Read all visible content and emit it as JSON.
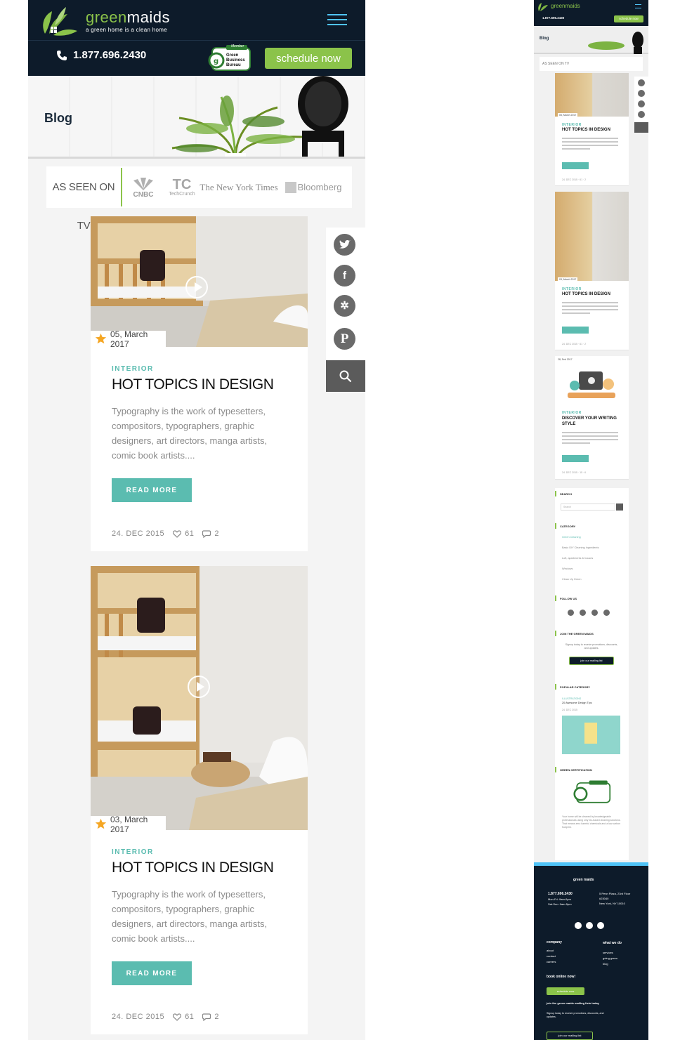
{
  "brand": {
    "name_green": "green",
    "name_white": "maids",
    "tagline": "a green home is a clean home"
  },
  "header": {
    "phone": "1.877.696.2430",
    "gbb_member": "Member",
    "gbb_name": "Green Business Bureau",
    "schedule_label": "schedule now"
  },
  "hero": {
    "title": "Blog"
  },
  "as_seen": {
    "label": "AS SEEN ON TV",
    "outlets": [
      "CNBC",
      "TechCrunch",
      "The New York Times",
      "Bloomberg"
    ]
  },
  "posts": [
    {
      "date": "05, March 2017",
      "category": "INTERIOR",
      "title": "HOT TOPICS IN DESIGN",
      "excerpt": "Typography is the work of typesetters, compositors, typographers, graphic designers, art directors, manga artists, comic book artists....",
      "read_more": "READ MORE",
      "posted": "24. DEC 2015",
      "likes": "61",
      "comments": "2"
    },
    {
      "date": "03, March 2017",
      "category": "INTERIOR",
      "title": "HOT TOPICS IN DESIGN",
      "excerpt": "Typography is the work of typesetters, compositors, typographers, graphic designers, art directors, manga artists, comic book artists....",
      "read_more": "READ MORE",
      "posted": "24. DEC 2015",
      "likes": "61",
      "comments": "2"
    }
  ],
  "thumb": {
    "brand": "greenmaids",
    "phone": "1.877.696.2430",
    "schedule": "schedule now",
    "hero": "Blog",
    "as_seen": "AS SEEN ON TV",
    "posts": [
      {
        "date": "05, March 2017",
        "category": "INTERIOR",
        "title": "HOT TOPICS IN DESIGN",
        "posted": "24. DEC 2015",
        "likes": "61",
        "comments": "2"
      },
      {
        "date": "03, March 2017",
        "category": "INTERIOR",
        "title": "HOT TOPICS IN DESIGN",
        "posted": "24. DEC 2015",
        "likes": "61",
        "comments": "2"
      },
      {
        "date": "28, Feb 2017",
        "category": "INTERIOR",
        "title": "DISCOVER YOUR WRITING STYLE",
        "posted": "24. DEC 2015",
        "likes": "15",
        "comments": "6"
      }
    ],
    "sidebar": {
      "search_heading": "SEARCH",
      "search_placeholder": "Search",
      "category_heading": "CATEGORY",
      "categories": [
        "Green Cleaning",
        "Basic DIY Cleaning Ingredients",
        "Loft, apartments & houses",
        "Windows",
        "Clean Up Green"
      ],
      "follow_heading": "FOLLOW US",
      "join_heading": "JOIN THE GREEN MAIDS",
      "join_text": "Signup today to receive promotions, discounts, and updates.",
      "join_button": "join our mailing list",
      "popular_heading": "POPULAR CATEGORY",
      "popular_category": "ILLUSTRATIONS",
      "popular_title": "20 Awesome Design Tips",
      "popular_date": "24. DEC 2015",
      "cert_heading": "GREEN CERTIFICATION",
      "cert_text": "Your home will be cleaned by knowledgeable professionals using only bio-based cleaning solutions. That means zero harmful chemicals and a low carbon footprint."
    },
    "footer": {
      "brand": "green maids",
      "phone": "1.877.696.2430",
      "hours1": "Mon-Fri: 9am-6pm",
      "hours2": "Sat-Sun: 9am-5pm",
      "address1": "5 Penn Plaza, 23rd Floor",
      "address2": "#23040",
      "address3": "New York, NY 10010",
      "company_heading": "company",
      "company_links": [
        "about",
        "contact",
        "careers"
      ],
      "whatwedo_heading": "what we do",
      "whatwedo_links": [
        "services",
        "going green",
        "blog"
      ],
      "book_heading": "book online now!",
      "book_button": "schedule now",
      "mailing_heading": "join the green maids mailing lists today",
      "mailing_text": "Signup today to receive promotions, discounts, and updates.",
      "mailing_button": "join our mailing list"
    }
  },
  "colors": {
    "navy": "#0d1b2a",
    "green": "#8bc34a",
    "teal": "#5bbcb0",
    "sky": "#4fc3f7"
  }
}
